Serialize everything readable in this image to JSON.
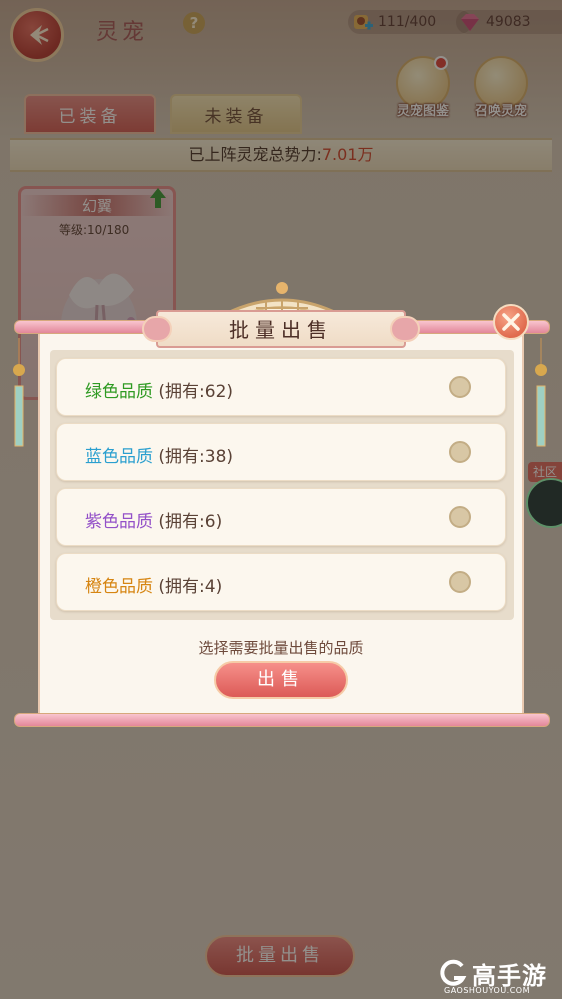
{
  "header": {
    "title": "灵宠",
    "help": "?",
    "pet_count": "111/400",
    "gem_count": "49083"
  },
  "side_buttons": {
    "codex_label": "灵宠图鉴",
    "summon_label": "召唤灵宠"
  },
  "tabs": {
    "equipped": "已装备",
    "unequipped": "未装备"
  },
  "power": {
    "label": "已上阵灵宠总势力:",
    "value": "7.01万"
  },
  "pet_card": {
    "name": "幻翼",
    "level": "等级:10/180"
  },
  "bottom": {
    "batch_sell": "批量出售",
    "community": "社区"
  },
  "watermark": {
    "name": "高手游",
    "url": "GAOSHOUYOU.COM"
  },
  "modal": {
    "title": "批量出售",
    "options": [
      {
        "quality": "绿色品质",
        "owned": " (拥有:62)",
        "color": "#2e9a22"
      },
      {
        "quality": "蓝色品质",
        "owned": " (拥有:38)",
        "color": "#2a9fcf"
      },
      {
        "quality": "紫色品质",
        "owned": " (拥有:6)",
        "color": "#9350c8"
      },
      {
        "quality": "橙色品质",
        "owned": " (拥有:4)",
        "color": "#d68512"
      }
    ],
    "hint": "选择需要批量出售的品质",
    "sell_label": "出售"
  },
  "colors": {
    "accent_red": "#dc5a57",
    "paper": "#fbf6ee",
    "power_value": "#d2452e"
  }
}
